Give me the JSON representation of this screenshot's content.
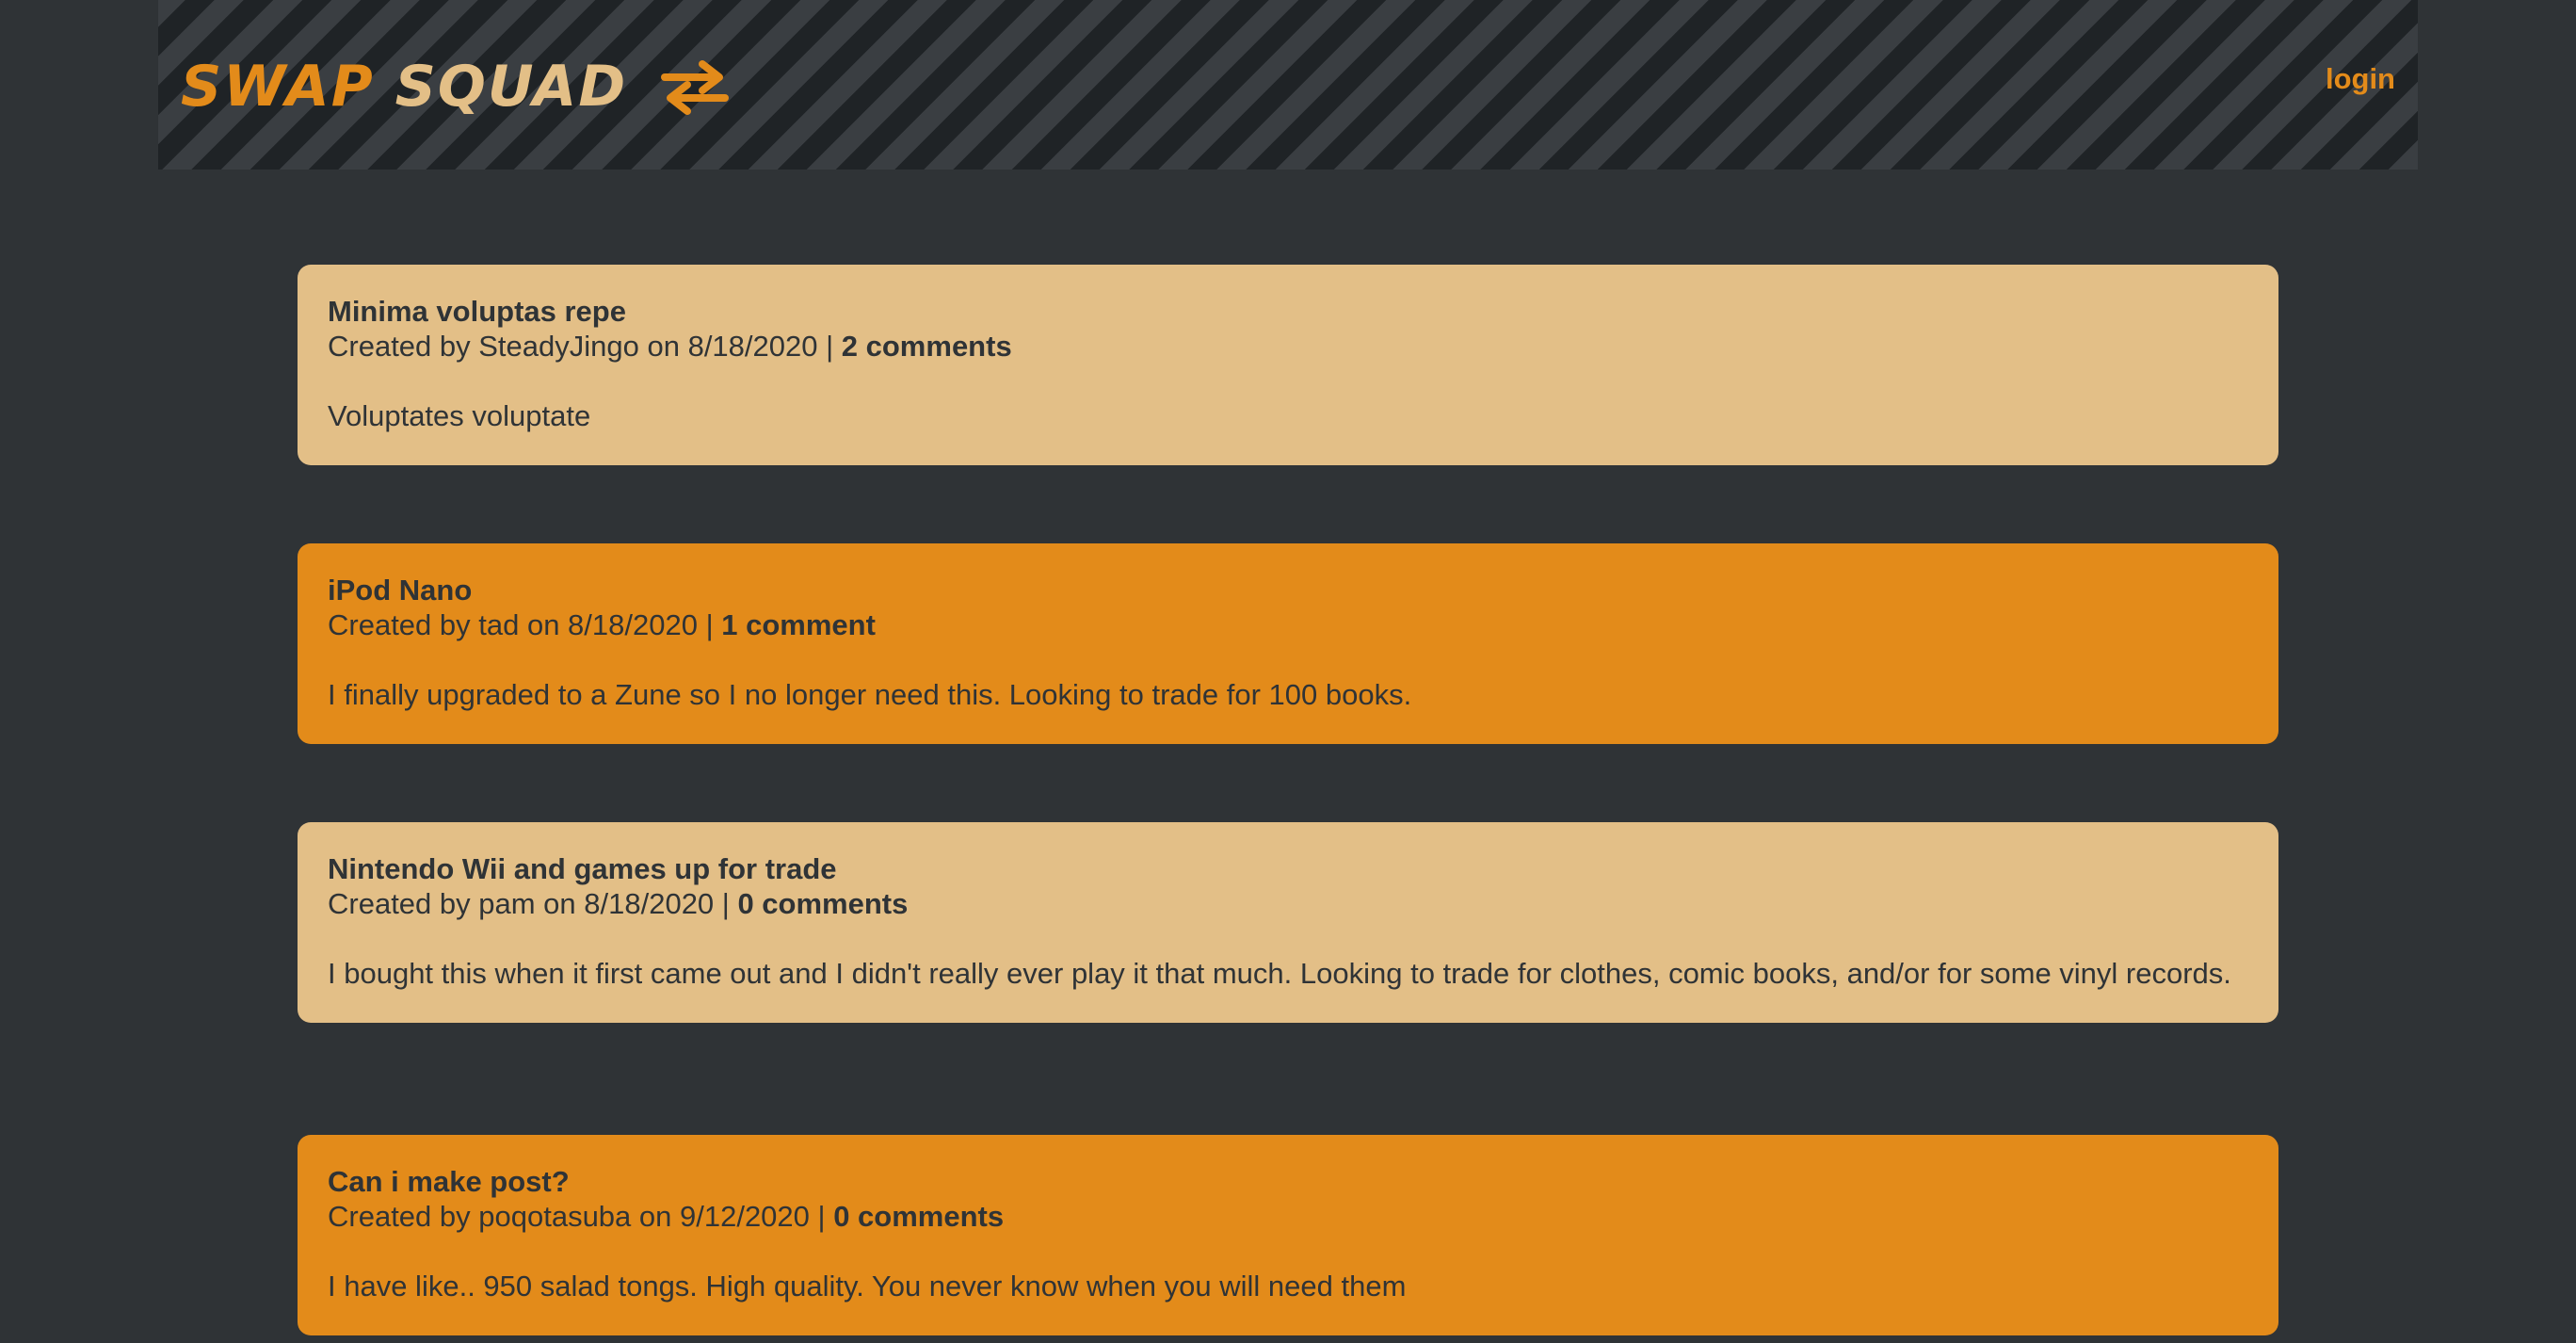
{
  "header": {
    "brand_word1": "SWAP",
    "brand_word2": "SQUAD",
    "brand_icon": "swap-arrows-icon",
    "login_label": "login"
  },
  "colors": {
    "background": "#2f3336",
    "accent_orange": "#e38b1a",
    "light_tan": "#e3bf87",
    "text_dark": "#2f3336"
  },
  "posts": [
    {
      "title": "Minima voluptas repe",
      "created_prefix": "Created by SteadyJingo on 8/18/2020 | ",
      "comments": "2 comments",
      "body": "Voluptates voluptate"
    },
    {
      "title": "iPod Nano",
      "created_prefix": "Created by tad on 8/18/2020 | ",
      "comments": "1 comment",
      "body": "I finally upgraded to a Zune so I no longer need this. Looking to trade for 100 books."
    },
    {
      "title": "Nintendo Wii and games up for trade",
      "created_prefix": "Created by pam on 8/18/2020 | ",
      "comments": "0 comments",
      "body": "I bought this when it first came out and I didn't really ever play it that much. Looking to trade for clothes, comic books, and/or for some vinyl records."
    },
    {
      "title": "Can i make post?",
      "created_prefix": "Created by poqotasuba on 9/12/2020 | ",
      "comments": "0 comments",
      "body": "I have like.. 950 salad tongs. High quality. You never know when you will need them"
    }
  ]
}
